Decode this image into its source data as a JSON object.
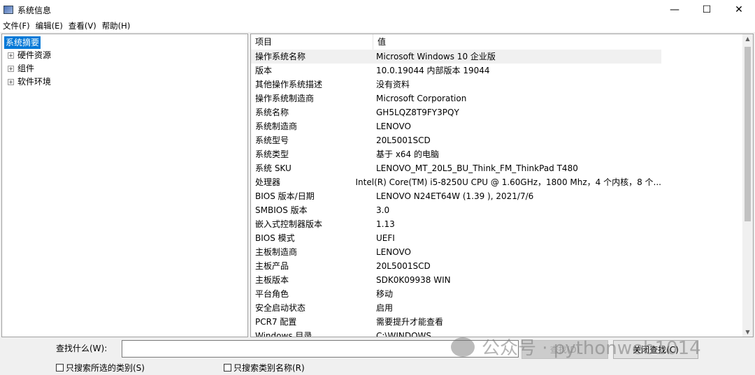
{
  "window": {
    "title": "系统信息",
    "minimize": "—",
    "maximize": "☐",
    "close": "✕"
  },
  "menu": [
    "文件(F)",
    "编辑(E)",
    "查看(V)",
    "帮助(H)"
  ],
  "tree": {
    "selected": "系统摘要",
    "children": [
      "硬件资源",
      "组件",
      "软件环境"
    ],
    "expand_glyph": "+"
  },
  "table": {
    "headers": [
      "项目",
      "值"
    ],
    "rows": [
      [
        "操作系统名称",
        "Microsoft Windows 10 企业版"
      ],
      [
        "版本",
        "10.0.19044 内部版本 19044"
      ],
      [
        "其他操作系统描述",
        "没有资料"
      ],
      [
        "操作系统制造商",
        "Microsoft Corporation"
      ],
      [
        "系统名称",
        "GH5LQZ8T9FY3PQY"
      ],
      [
        "系统制造商",
        "LENOVO"
      ],
      [
        "系统型号",
        "20L5001SCD"
      ],
      [
        "系统类型",
        "基于 x64 的电脑"
      ],
      [
        "系统 SKU",
        "LENOVO_MT_20L5_BU_Think_FM_ThinkPad T480"
      ],
      [
        "处理器",
        "Intel(R) Core(TM) i5-8250U CPU @ 1.60GHz，1800 Mhz，4 个内核，8 个..."
      ],
      [
        "BIOS 版本/日期",
        "LENOVO N24ET64W (1.39 ), 2021/7/6"
      ],
      [
        "SMBIOS 版本",
        "3.0"
      ],
      [
        "嵌入式控制器版本",
        "1.13"
      ],
      [
        "BIOS 模式",
        "UEFI"
      ],
      [
        "主板制造商",
        "LENOVO"
      ],
      [
        "主板产品",
        "20L5001SCD"
      ],
      [
        "主板版本",
        "SDK0K09938 WIN"
      ],
      [
        "平台角色",
        "移动"
      ],
      [
        "安全启动状态",
        "启用"
      ],
      [
        "PCR7 配置",
        "需要提升才能查看"
      ],
      [
        "Windows 目录",
        "C:\\WINDOWS"
      ]
    ]
  },
  "find": {
    "label": "查找什么(W):",
    "value": "",
    "find_button": "查找(D)",
    "close_button": "关闭查找(C)",
    "check1": "只搜索所选的类别(S)",
    "check2": "只搜索类别名称(R)"
  },
  "watermark": "公众号 · pythonweb1014"
}
